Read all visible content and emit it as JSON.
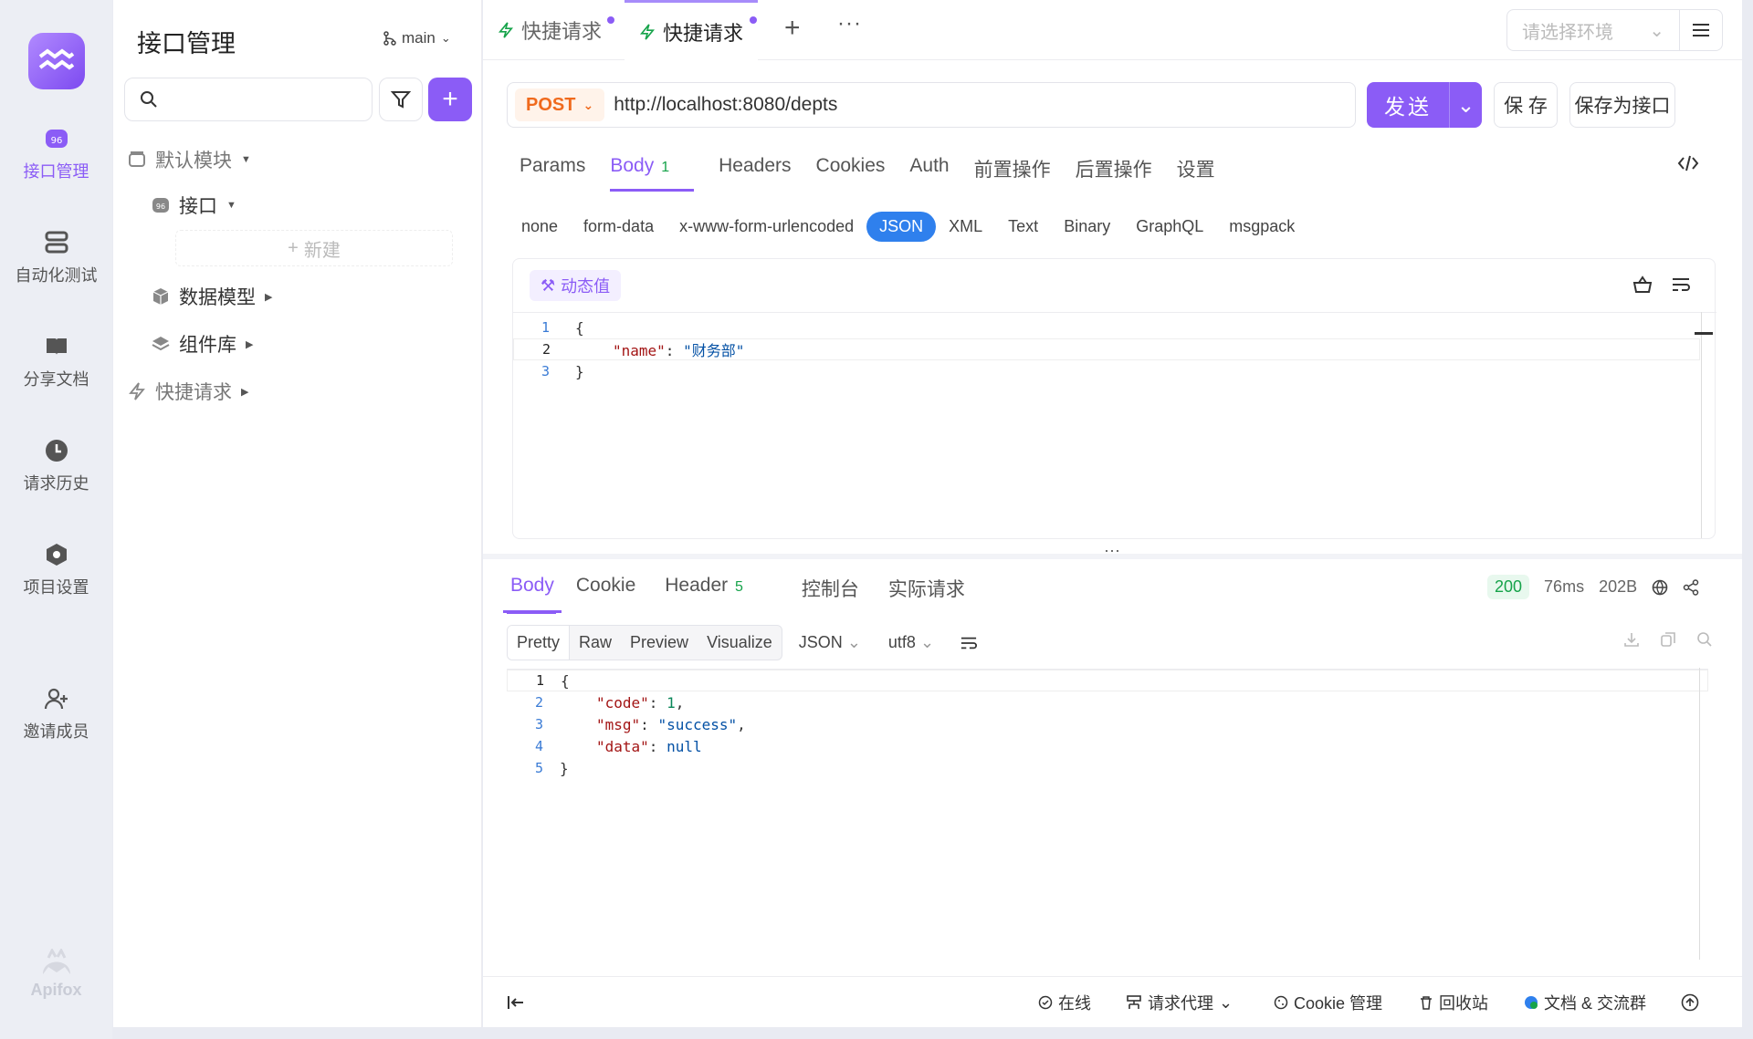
{
  "rail": {
    "brand": "Apifox",
    "items": [
      {
        "label": "接口管理",
        "icon": "api-icon"
      },
      {
        "label": "自动化测试",
        "icon": "stack-icon"
      },
      {
        "label": "分享文档",
        "icon": "book-icon"
      },
      {
        "label": "请求历史",
        "icon": "clock-icon"
      },
      {
        "label": "项目设置",
        "icon": "settings-icon"
      },
      {
        "label": "邀请成员",
        "icon": "user-plus-icon"
      }
    ]
  },
  "tree": {
    "title": "接口管理",
    "branch": "main",
    "new_label": "新建",
    "rows": [
      {
        "label": "默认模块"
      },
      {
        "label": "接口"
      },
      {
        "label": "数据模型"
      },
      {
        "label": "组件库"
      },
      {
        "label": "快捷请求"
      }
    ]
  },
  "tabs": [
    {
      "label": "快捷请求"
    },
    {
      "label": "快捷请求"
    }
  ],
  "env": {
    "placeholder": "请选择环境"
  },
  "request": {
    "method": "POST",
    "url": "http://localhost:8080/depts",
    "send": "发送",
    "save": "保 存",
    "save_as": "保存为接口",
    "tabs": [
      "Params",
      "Body",
      "Headers",
      "Cookies",
      "Auth",
      "前置操作",
      "后置操作",
      "设置"
    ],
    "body_badge": "1",
    "body_types": [
      "none",
      "form-data",
      "x-www-form-urlencoded",
      "JSON",
      "XML",
      "Text",
      "Binary",
      "GraphQL",
      "msgpack"
    ],
    "dynamic_label": "动态值",
    "code_lines": [
      {
        "n": "1",
        "t": "{"
      },
      {
        "n": "2",
        "k": "\"name\"",
        "sep": ": ",
        "v": "\"财务部\""
      },
      {
        "n": "3",
        "t": "}"
      }
    ]
  },
  "response": {
    "tabs": [
      "Body",
      "Cookie",
      "Header",
      "控制台",
      "实际请求"
    ],
    "header_count": "5",
    "status_code": "200",
    "time": "76ms",
    "size": "202B",
    "views": [
      "Pretty",
      "Raw",
      "Preview",
      "Visualize"
    ],
    "format": "JSON",
    "encoding": "utf8",
    "code_lines": [
      {
        "n": "1",
        "t": "{"
      },
      {
        "n": "2",
        "k": "\"code\"",
        "sep": ": ",
        "v": "1",
        "tail": ","
      },
      {
        "n": "3",
        "k": "\"msg\"",
        "sep": ": ",
        "v": "\"success\"",
        "tail": ","
      },
      {
        "n": "4",
        "k": "\"data\"",
        "sep": ": ",
        "v": "null"
      },
      {
        "n": "5",
        "t": "}"
      }
    ]
  },
  "footer": {
    "online": "在线",
    "proxy": "请求代理",
    "cookie": "Cookie 管理",
    "trash": "回收站",
    "community": "文档 & 交流群"
  },
  "colors": {
    "accent": "#8b5cf6",
    "method": "#f06a1d",
    "json_pill": "#2f80ed",
    "ok": "#16a34a"
  }
}
